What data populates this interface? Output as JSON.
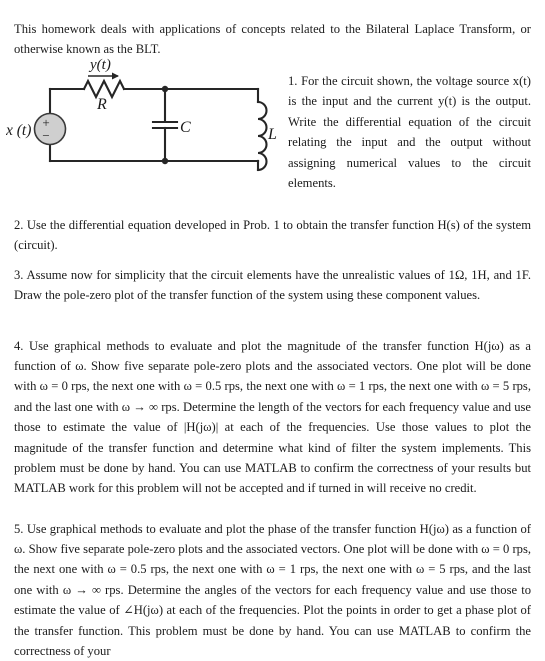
{
  "document": {
    "intro": "This homework deals with applications of concepts related to the Bilateral Laplace Transform, or otherwise known as the BLT.",
    "problem_1": "1. For the circuit shown, the voltage source x(t) is the input and the current y(t) is the output. Write the differential equation of the circuit relating the input and the output without assigning numerical values to the circuit elements.",
    "problem_2": "2. Use the differential equation developed in Prob. 1 to obtain the transfer function H(s) of the system (circuit).",
    "problem_3": "3. Assume now for simplicity that the circuit elements have the unrealistic values of 1Ω, 1H, and 1F. Draw the pole-zero plot of the transfer function of the system using these component values.",
    "problem_4": "4. Use graphical methods to evaluate and plot the magnitude of the transfer function H(jω) as a function of ω. Show five separate pole-zero plots and the associated vectors. One plot will be done with ω = 0 rps, the next one with ω = 0.5 rps, the next one with ω = 1 rps, the next one with ω = 5 rps, and the last one with ω → ∞ rps. Determine the length of the vectors for each frequency value and use those to estimate the value of |H(jω)| at each of the frequencies. Use those values to plot the magnitude of the transfer function and determine what kind of filter the system implements. This problem must be done by hand. You can use MATLAB to confirm the correctness of your results but MATLAB work for this problem will not be accepted and if turned in will receive no credit.",
    "problem_5": "5. Use graphical methods to evaluate and plot the phase of the transfer function H(jω) as a function of ω. Show five separate pole-zero plots and the associated vectors. One plot will be done with ω = 0 rps, the next one with ω = 0.5 rps, the next one with ω = 1 rps, the next one with ω = 5 rps, and the last one with ω → ∞ rps. Determine the angles of the vectors for each frequency value and use those to estimate the value of ∠H(jω) at each of the frequencies. Plot the points in order to get a phase plot of the transfer function. This problem must be done by hand. You can use MATLAB to confirm the correctness of your"
  },
  "circuit": {
    "caption_labels": {
      "source": "x (t)",
      "current": "y(t)",
      "resistor": "R",
      "capacitor": "C",
      "inductor": "L",
      "source_plus": "+",
      "source_minus": "−"
    },
    "colors": {
      "wire": "#262626",
      "source_fill": "#cfcfcf",
      "text": "#1b1b1b"
    }
  }
}
